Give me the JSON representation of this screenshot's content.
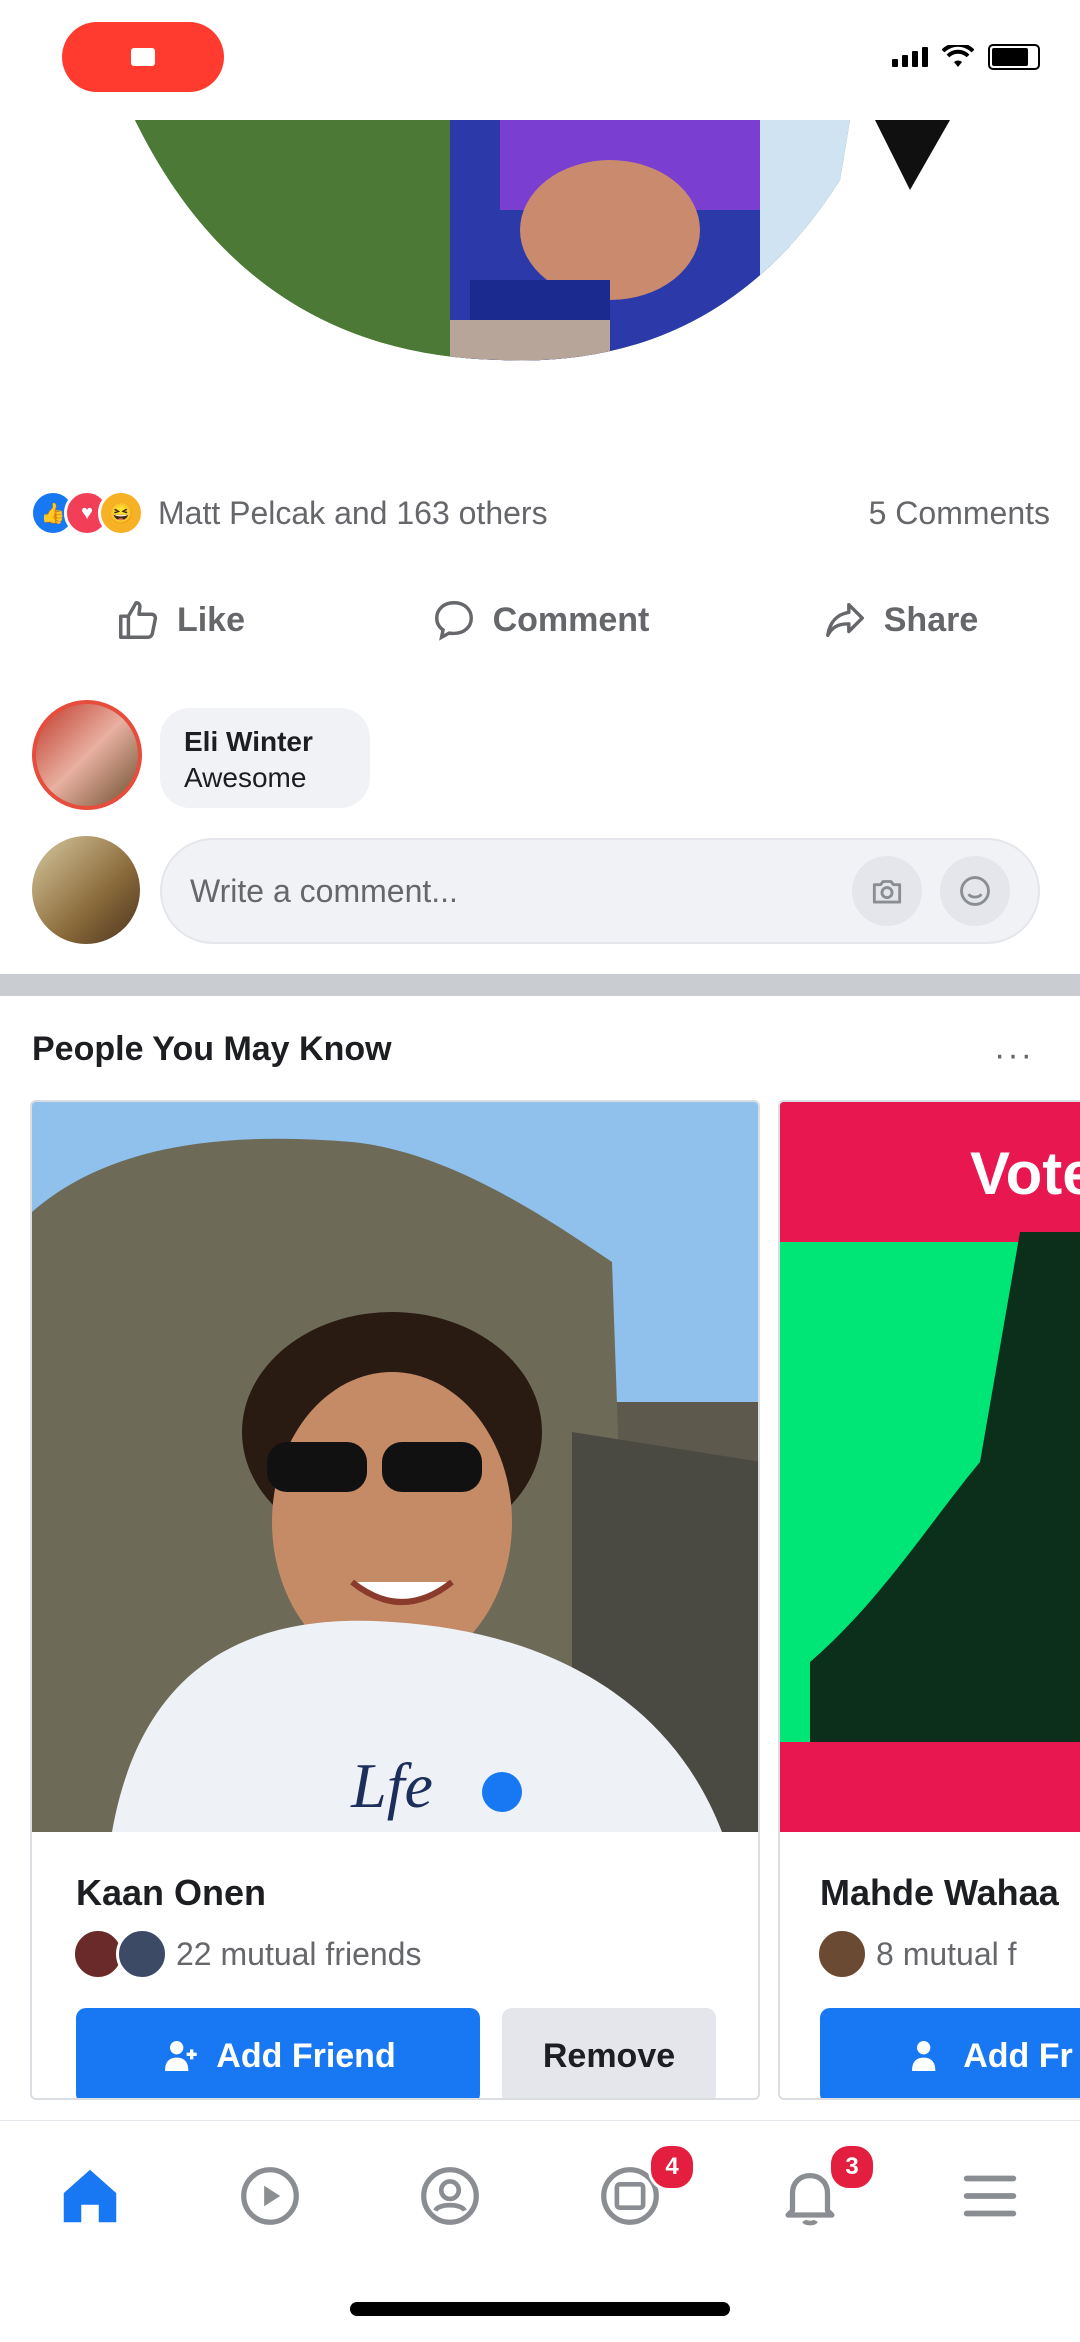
{
  "reactions": {
    "summary": "Matt Pelcak and 163 others",
    "comments": "5 Comments"
  },
  "actions": {
    "like": "Like",
    "comment": "Comment",
    "share": "Share"
  },
  "comment": {
    "author": "Eli Winter",
    "text": "Awesome"
  },
  "write_comment": {
    "placeholder": "Write a comment..."
  },
  "pymk": {
    "title": "People You May Know",
    "more": "···",
    "cards": [
      {
        "name": "Kaan Onen",
        "mutual": "22 mutual friends",
        "add_label": "Add Friend",
        "remove_label": "Remove"
      },
      {
        "name": "Mahde Wahaa",
        "mutual": "8 mutual f",
        "add_label": "Add Fr",
        "banner_text": "Vote"
      }
    ]
  },
  "nav": {
    "notifications_badge": "4",
    "activity_badge": "3"
  },
  "colors": {
    "brand_blue": "#1877f2",
    "badge_red": "#e41e3f",
    "record_red": "#ff3b30"
  }
}
